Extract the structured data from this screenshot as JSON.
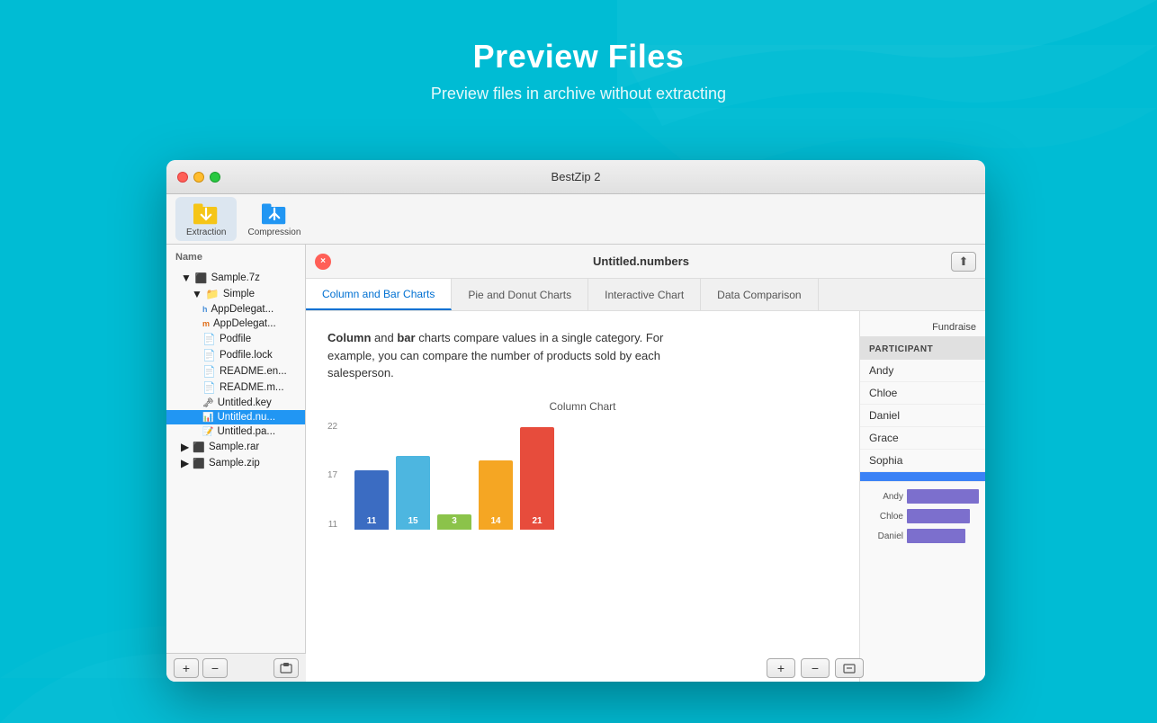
{
  "page": {
    "title": "Preview Files",
    "subtitle": "Preview files in archive without extracting",
    "background_color": "#00bcd4"
  },
  "window": {
    "title": "BestZip 2",
    "traffic_lights": [
      "close",
      "minimize",
      "maximize"
    ]
  },
  "toolbar": {
    "extraction_label": "Extraction",
    "compression_label": "Compression"
  },
  "sidebar": {
    "column_header": "Name",
    "items": [
      {
        "label": "Sample.7z",
        "type": "archive",
        "level": 0,
        "expanded": true
      },
      {
        "label": "Simple",
        "type": "folder",
        "level": 1,
        "expanded": true
      },
      {
        "label": "AppDelegate",
        "type": "file-h",
        "level": 2
      },
      {
        "label": "AppDelegate",
        "type": "file-m",
        "level": 2
      },
      {
        "label": "Podfile",
        "type": "file",
        "level": 2
      },
      {
        "label": "Podfile.lock",
        "type": "file",
        "level": 2
      },
      {
        "label": "README.en",
        "type": "file",
        "level": 2
      },
      {
        "label": "README.md",
        "type": "file",
        "level": 2
      },
      {
        "label": "Untitled.key",
        "type": "file-key",
        "level": 2
      },
      {
        "label": "Untitled.num",
        "type": "file-num",
        "level": 2,
        "selected": true
      },
      {
        "label": "Untitled.pag",
        "type": "file-pag",
        "level": 2
      },
      {
        "label": "Sample.rar",
        "type": "archive-rar",
        "level": 0
      },
      {
        "label": "Sample.zip",
        "type": "archive-zip",
        "level": 0
      }
    ]
  },
  "bottom_toolbar": {
    "add_label": "+",
    "remove_label": "−",
    "print_label": "⎙"
  },
  "preview": {
    "title": "Untitled.numbers",
    "close_label": "×",
    "share_label": "⬆",
    "tabs": [
      {
        "label": "Column and Bar Charts",
        "active": true
      },
      {
        "label": "Pie and Donut Charts",
        "active": false
      },
      {
        "label": "Interactive Chart",
        "active": false
      },
      {
        "label": "Data Comparison",
        "active": false
      }
    ],
    "fundraise_label": "Fundraise",
    "chart_description": {
      "text_bold1": "Column",
      "text1": " and bar ",
      "text_bold2": "bar",
      "text2": " charts compare values in a single category. For example, you can compare the number of products sold by each salesperson."
    },
    "column_chart_title": "Column Chart",
    "y_axis_labels": [
      "22",
      "17",
      "11"
    ],
    "bars": [
      {
        "value": 11,
        "color": "#3b6cc2",
        "height_pct": 50
      },
      {
        "value": 15,
        "color": "#4db6e0",
        "height_pct": 68
      },
      {
        "value": 3,
        "color": "#8bc34a",
        "height_pct": 14
      },
      {
        "value": 14,
        "color": "#f5a623",
        "height_pct": 64
      },
      {
        "value": 21,
        "color": "#e74c3c",
        "height_pct": 95
      }
    ],
    "participant_header": "PARTICIPANT",
    "participants": [
      {
        "name": "Andy",
        "selected": false
      },
      {
        "name": "Chloe",
        "selected": false
      },
      {
        "name": "Daniel",
        "selected": false
      },
      {
        "name": "Grace",
        "selected": false
      },
      {
        "name": "Sophia",
        "selected": false
      }
    ],
    "right_bars": [
      {
        "name": "Andy",
        "width": 80
      },
      {
        "name": "Chloe",
        "width": 70
      },
      {
        "name": "Daniel",
        "width": 65
      }
    ]
  }
}
